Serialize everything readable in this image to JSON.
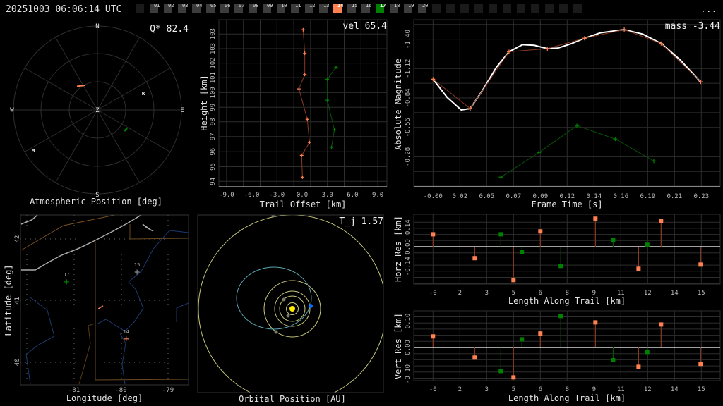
{
  "header": {
    "title": "20251003 06:06:14 UTC",
    "menu": "..."
  },
  "frames": {
    "labels": [
      "01",
      "02",
      "03",
      "04",
      "05",
      "06",
      "07",
      "08",
      "09",
      "10",
      "11",
      "12",
      "13",
      "14",
      "15",
      "16",
      "17",
      "18",
      "19",
      "20"
    ],
    "highlight": {
      "14": "#ff8050",
      "17": "#008000"
    },
    "blank_before": 1,
    "blank_after": 11
  },
  "colors": {
    "orange": "#ff8050",
    "orange_line": "#8b3a20",
    "green": "#008000",
    "green_line": "#0a4f0a",
    "fit": "#ffffff",
    "orbit": "#c8c87a",
    "meteor_orbit": "#5aa6b4",
    "sun": "#ffee00",
    "earth": "#0a6cff",
    "planet": "#7a7a6a",
    "river": "#1a3a6e",
    "border": "#7a5020",
    "shore": "#aaaaaa"
  },
  "polar": {
    "caption": "Atmospheric Position [deg]",
    "metric": "Q* 82.4",
    "compass": {
      "n": "N",
      "s": "S",
      "e": "E",
      "w": "W",
      "z": "Z"
    },
    "stations": [
      "R",
      "M"
    ]
  },
  "trail": {
    "metric": "vel 65.4",
    "xlabel": "Trail Offset [km]",
    "ylabel": "Height [km]",
    "xticks": [
      {
        "v": -9,
        "label": "-9.0"
      },
      {
        "v": -6,
        "label": "-6.0"
      },
      {
        "v": -3,
        "label": "-3.0"
      },
      {
        "v": 0,
        "label": "0.0"
      },
      {
        "v": 3,
        "label": "3.0"
      },
      {
        "v": 6,
        "label": "6.0"
      },
      {
        "v": 9,
        "label": "9.0"
      }
    ],
    "yticks": [
      {
        "v": 94.0,
        "label": "94"
      },
      {
        "v": 94.94,
        "label": "95"
      },
      {
        "v": 95.9,
        "label": "96"
      },
      {
        "v": 96.87,
        "label": "97"
      },
      {
        "v": 97.82,
        "label": "98"
      },
      {
        "v": 98.75,
        "label": "99"
      },
      {
        "v": 99.69,
        "label": "100"
      },
      {
        "v": 100.65,
        "label": "101"
      },
      {
        "v": 101.58,
        "label": "102"
      },
      {
        "v": 102.51,
        "label": "103"
      },
      {
        "v": 103.45,
        "label": "103"
      }
    ],
    "series": [
      {
        "name": "14",
        "color": "orange",
        "points": [
          [
            0.11,
            103.72
          ],
          [
            0.31,
            102.21
          ],
          [
            0.31,
            100.85
          ],
          [
            -0.39,
            99.93
          ],
          [
            0.61,
            97.98
          ],
          [
            0.87,
            96.49
          ],
          [
            -0.06,
            95.67
          ],
          [
            0.03,
            94.27
          ]
        ]
      },
      {
        "name": "17",
        "color": "green",
        "points": [
          [
            4.03,
            101.32
          ],
          [
            2.99,
            100.55
          ],
          [
            2.99,
            99.2
          ],
          [
            3.83,
            97.31
          ],
          [
            3.49,
            96.18
          ]
        ]
      }
    ]
  },
  "chart_data": [
    {
      "type": "line",
      "title": "mass -3.44",
      "xlabel": "Frame Time [s]",
      "ylabel": "Absolute Magnitude",
      "xticks": [
        "-0.00",
        "0.02",
        "0.05",
        "0.07",
        "0.09",
        "0.12",
        "0.14",
        "0.16",
        "0.19",
        "0.21",
        "0.23"
      ],
      "yticks": [
        {
          "v": -1.4,
          "label": "-1.40"
        },
        {
          "v": -1.12,
          "label": "-1.12"
        },
        {
          "v": -0.84,
          "label": "-0.84"
        },
        {
          "v": -0.56,
          "label": "-0.56"
        },
        {
          "v": -0.28,
          "label": "-0.28"
        }
      ],
      "series": [
        {
          "name": "14",
          "color": "orange",
          "x": [
            0,
            0.0323,
            0.066,
            0.0993,
            0.1315,
            0.166,
            0.198,
            0.2324
          ],
          "y": [
            -1.019,
            -0.739,
            -1.281,
            -1.31,
            -1.409,
            -1.491,
            -1.359,
            -0.994
          ]
        },
        {
          "name": "17",
          "color": "green",
          "x": [
            0.0589,
            0.092,
            0.1249,
            0.1582,
            0.1917
          ],
          "y": [
            -0.086,
            -0.321,
            -0.576,
            -0.449,
            -0.24
          ]
        },
        {
          "name": "fit",
          "color": "fit",
          "x": [
            0,
            0.0123,
            0.0245,
            0.0323,
            0.0429,
            0.0552,
            0.066,
            0.0777,
            0.0879,
            0.0993,
            0.1083,
            0.1206,
            0.1315,
            0.1451,
            0.166,
            0.1819,
            0.1982,
            0.2146,
            0.2322
          ],
          "y": [
            -1.019,
            -0.845,
            -0.726,
            -0.739,
            -0.912,
            -1.135,
            -1.281,
            -1.348,
            -1.342,
            -1.31,
            -1.315,
            -1.359,
            -1.409,
            -1.46,
            -1.491,
            -1.449,
            -1.359,
            -1.203,
            -0.994
          ]
        }
      ]
    },
    {
      "type": "scatter",
      "title": "Horizontal residuals",
      "xlabel": "Length Along Trail [km]",
      "ylabel": "Horz Res [km]",
      "xticks": [
        "-0",
        "2",
        "3",
        "5",
        "6",
        "8",
        "9",
        "11",
        "12",
        "14",
        "15"
      ],
      "yticks": [
        {
          "v": 0.14,
          "label": "0.14"
        },
        {
          "v": 0.0,
          "label": "0.00"
        },
        {
          "v": -0.14,
          "label": "-0.14"
        }
      ],
      "series": [
        {
          "name": "14",
          "color": "orange",
          "x": [
            0,
            2.33,
            4.5,
            6.0,
            9.08,
            11.49,
            12.75,
            14.96
          ],
          "y": [
            0.089,
            -0.082,
            -0.239,
            0.11,
            0.201,
            -0.158,
            0.186,
            -0.128
          ]
        },
        {
          "name": "17",
          "color": "green",
          "x": [
            3.79,
            4.97,
            7.14,
            10.07,
            11.98
          ],
          "y": [
            0.089,
            -0.037,
            -0.138,
            0.049,
            0.014
          ]
        }
      ]
    },
    {
      "type": "scatter",
      "title": "Vertical residuals",
      "xlabel": "Length Along Trail [km]",
      "ylabel": "Vert Res [km]",
      "xticks": [
        "-0",
        "2",
        "3",
        "5",
        "6",
        "8",
        "9",
        "11",
        "12",
        "14",
        "15"
      ],
      "yticks": [
        {
          "v": 0.1,
          "label": "0.10"
        },
        {
          "v": 0.0,
          "label": "0.00"
        },
        {
          "v": -0.1,
          "label": "-0.10"
        }
      ],
      "series": [
        {
          "name": "14",
          "color": "orange",
          "x": [
            0,
            2.33,
            4.5,
            6.0,
            9.08,
            11.49,
            12.75,
            14.96
          ],
          "y": [
            0.042,
            -0.038,
            -0.113,
            0.053,
            0.095,
            -0.073,
            0.087,
            -0.062
          ]
        },
        {
          "name": "17",
          "color": "green",
          "x": [
            3.79,
            4.97,
            7.14,
            10.07,
            11.98
          ],
          "y": [
            -0.089,
            0.031,
            0.119,
            -0.048,
            -0.017
          ]
        }
      ]
    }
  ],
  "map": {
    "xlabel": "Longitude [deg]",
    "ylabel": "Latitude [deg]",
    "xticks": [
      "-81",
      "-80",
      "-79"
    ],
    "yticks": [
      "42",
      "41",
      "40"
    ],
    "stations": [
      {
        "label": "17",
        "color": "green",
        "lon": -81.16,
        "lat": 41.3
      },
      {
        "label": "15",
        "color": "#888888",
        "lon": -79.67,
        "lat": 41.46
      },
      {
        "label": "14",
        "color": "orange",
        "lon": -79.9,
        "lat": 40.37
      }
    ],
    "trail": [
      [
        -80.49,
        40.86
      ],
      [
        -80.39,
        40.91
      ]
    ]
  },
  "orbit": {
    "caption": "Orbital Position [AU]",
    "metric": "T_j 1.57"
  }
}
